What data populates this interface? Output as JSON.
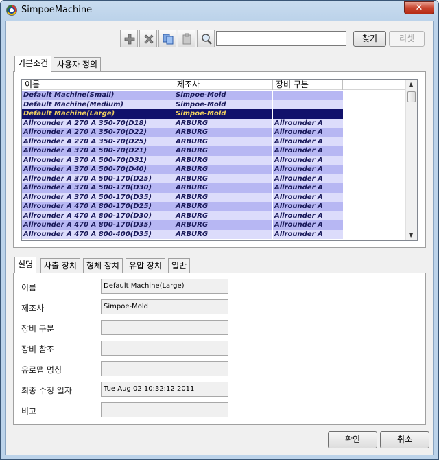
{
  "window": {
    "title": "SimpoeMachine",
    "close_glyph": "✕"
  },
  "toolbar": {
    "buttons": [
      {
        "icon": "add-icon"
      },
      {
        "icon": "delete-icon"
      },
      {
        "icon": "copy-icon"
      },
      {
        "icon": "paste-icon"
      },
      {
        "icon": "search-zoom-icon"
      }
    ],
    "search_value": "",
    "find_label": "찾기",
    "reset_label": "리셋"
  },
  "top_tabs": [
    "기본조건",
    "사용자 정의"
  ],
  "grid": {
    "columns": [
      "이름",
      "제조사",
      "장비 구분"
    ],
    "rows": [
      {
        "name": "Default Machine(Small)",
        "maker": "Simpoe-Mold",
        "type": ""
      },
      {
        "name": "Default Machine(Medium)",
        "maker": "Simpoe-Mold",
        "type": ""
      },
      {
        "name": "Default Machine(Large)",
        "maker": "Simpoe-Mold",
        "type": ""
      },
      {
        "name": "Allrounder A 270 A 350-70(D18)",
        "maker": "ARBURG",
        "type": "Allrounder A"
      },
      {
        "name": "Allrounder A 270 A 350-70(D22)",
        "maker": "ARBURG",
        "type": "Allrounder A"
      },
      {
        "name": "Allrounder A 270 A 350-70(D25)",
        "maker": "ARBURG",
        "type": "Allrounder A"
      },
      {
        "name": "Allrounder A 370 A 500-70(D21)",
        "maker": "ARBURG",
        "type": "Allrounder A"
      },
      {
        "name": "Allrounder A 370 A 500-70(D31)",
        "maker": "ARBURG",
        "type": "Allrounder A"
      },
      {
        "name": "Allrounder A 370 A 500-70(D40)",
        "maker": "ARBURG",
        "type": "Allrounder A"
      },
      {
        "name": "Allrounder A 370 A 500-170(D25)",
        "maker": "ARBURG",
        "type": "Allrounder A"
      },
      {
        "name": "Allrounder A 370 A 500-170(D30)",
        "maker": "ARBURG",
        "type": "Allrounder A"
      },
      {
        "name": "Allrounder A 370 A 500-170(D35)",
        "maker": "ARBURG",
        "type": "Allrounder A"
      },
      {
        "name": "Allrounder A 470 A 800-170(D25)",
        "maker": "ARBURG",
        "type": "Allrounder A"
      },
      {
        "name": "Allrounder A 470 A 800-170(D30)",
        "maker": "ARBURG",
        "type": "Allrounder A"
      },
      {
        "name": "Allrounder A 470 A 800-170(D35)",
        "maker": "ARBURG",
        "type": "Allrounder A"
      },
      {
        "name": "Allrounder A 470 A 800-400(D35)",
        "maker": "ARBURG",
        "type": "Allrounder A"
      }
    ],
    "selected_index": 2,
    "colors": {
      "odd": "#b7b7f3",
      "even": "#dcdcfb",
      "selected": "#11116b",
      "selected_text": "#f0d060",
      "text": "#1a1a5a"
    }
  },
  "bottom_tabs": [
    "설명",
    "사출 장치",
    "형체 장치",
    "유압 장치",
    "일반"
  ],
  "properties": [
    {
      "label": "이름",
      "value": "Default Machine(Large)"
    },
    {
      "label": "제조사",
      "value": "Simpoe-Mold"
    },
    {
      "label": "장비 구분",
      "value": ""
    },
    {
      "label": "장비 참조",
      "value": ""
    },
    {
      "label": "유로맵 명칭",
      "value": ""
    },
    {
      "label": "최종 수정 일자",
      "value": "Tue Aug 02 10:32:12 2011"
    },
    {
      "label": "비고",
      "value": ""
    }
  ],
  "footer": {
    "ok_label": "확인",
    "cancel_label": "취소"
  }
}
